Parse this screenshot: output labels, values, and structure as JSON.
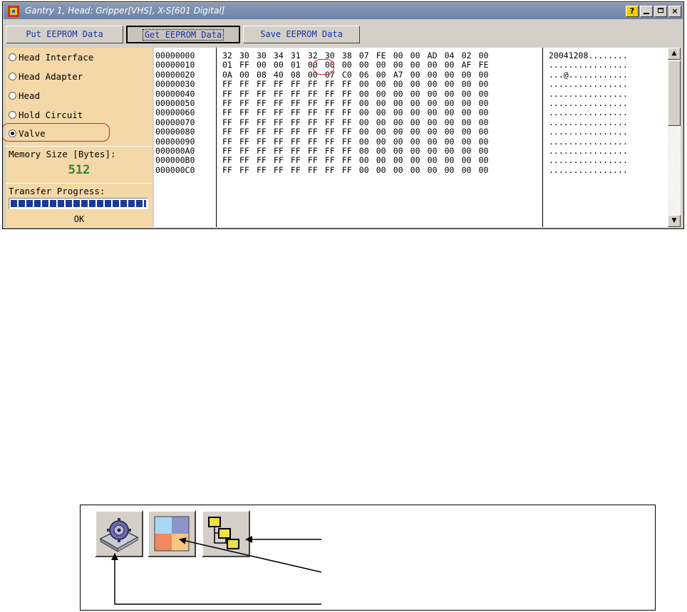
{
  "window": {
    "title": "Gantry 1, Head: Gripper[VHS], X-S[601 Digital]",
    "help_label": "?",
    "close_label": "×"
  },
  "toolbar": {
    "put_label": "Put EEPROM Data",
    "get_label": "Get EEPROM Data",
    "save_label": "Save EEPROM Data"
  },
  "left_panel": {
    "options": [
      {
        "label": "Head Interface",
        "checked": false
      },
      {
        "label": "Head Adapter",
        "checked": false
      },
      {
        "label": "Head",
        "checked": false
      },
      {
        "label": "Hold Circuit",
        "checked": false
      },
      {
        "label": "Valve",
        "checked": true
      }
    ],
    "memory_label": "Memory Size [Bytes]:",
    "memory_value": "512",
    "progress_label": "Transfer Progress:",
    "progress_fraction": 1.0,
    "progress_status": "OK"
  },
  "hex": {
    "rows": [
      {
        "addr": "00000000",
        "bytes": "32 30 30 34 31 32 30 38 07 FE 00 00 AD 04 02 00",
        "ascii": "20041208........"
      },
      {
        "addr": "00000010",
        "bytes": "01 FF 00 00 01 00 00 00 00 00 00 00 00 00 AF FE",
        "ascii": "................"
      },
      {
        "addr": "00000020",
        "bytes": "0A 00 08 40 08 00 07 C0 06 00 A7 00 00 00 00 00",
        "ascii": "...@............"
      },
      {
        "addr": "00000030",
        "bytes": "FF FF FF FF FF FF FF FF 00 00 00 00 00 00 00 00",
        "ascii": "................"
      },
      {
        "addr": "00000040",
        "bytes": "FF FF FF FF FF FF FF FF 00 00 00 00 00 00 00 00",
        "ascii": "................"
      },
      {
        "addr": "00000050",
        "bytes": "FF FF FF FF FF FF FF FF 00 00 00 00 00 00 00 00",
        "ascii": "................"
      },
      {
        "addr": "00000060",
        "bytes": "FF FF FF FF FF FF FF FF 00 00 00 00 00 00 00 00",
        "ascii": "................"
      },
      {
        "addr": "00000070",
        "bytes": "FF FF FF FF FF FF FF FF 00 00 00 00 00 00 00 00",
        "ascii": "................"
      },
      {
        "addr": "00000080",
        "bytes": "FF FF FF FF FF FF FF FF 00 00 00 00 00 00 00 00",
        "ascii": "................"
      },
      {
        "addr": "00000090",
        "bytes": "FF FF FF FF FF FF FF FF 00 00 00 00 00 00 00 00",
        "ascii": "................"
      },
      {
        "addr": "000000A0",
        "bytes": "FF FF FF FF FF FF FF FF 00 00 00 00 00 00 00 00",
        "ascii": "................"
      },
      {
        "addr": "000000B0",
        "bytes": "FF FF FF FF FF FF FF FF 00 00 00 00 00 00 00 00",
        "ascii": "................"
      },
      {
        "addr": "000000C0",
        "bytes": "FF FF FF FF FF FF FF FF 00 00 00 00 00 00 00 00",
        "ascii": "................"
      }
    ]
  },
  "scrollbar": {
    "up_glyph": "▲",
    "down_glyph": "▼"
  },
  "colors": {
    "titlebar": "#7a8cb0",
    "panel_bg": "#f4d8a8",
    "button_text": "#1830a0",
    "memory_value": "#2f8a2f",
    "progress_fill": "#1a3a9a",
    "annotation": "#e0202a"
  },
  "figure": {
    "icons": [
      "drive-settings-icon",
      "color-palette-icon",
      "hierarchy-tree-icon"
    ]
  }
}
